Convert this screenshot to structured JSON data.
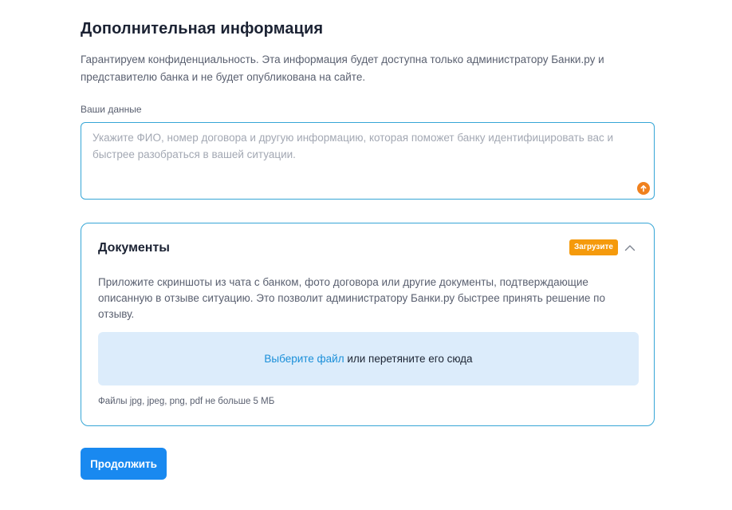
{
  "section": {
    "title": "Дополнительная информация",
    "description": "Гарантируем конфиденциальность. Эта информация будет доступна только администратору Банки.ру и представителю банка и не будет опубликована на сайте."
  },
  "your_data": {
    "label": "Ваши данные",
    "value": "",
    "placeholder": "Укажите ФИО, номер договора и другую информацию, которая поможет банку идентифицировать вас и быстрее разобраться в вашей ситуации.",
    "indicator_icon": "upload-warning-icon"
  },
  "documents": {
    "title": "Документы",
    "badge": "Загрузите",
    "collapse_icon": "chevron-up-icon",
    "description": "Приложите скриншоты из чата с банком, фото договора или другие документы, подтверждающие описанную в отзыве ситуацию. Это позволит администратору Банки.ру быстрее принять решение по отзыву.",
    "dropzone": {
      "link_text": "Выберите файл",
      "rest_text": " или перетяните его сюда"
    },
    "files_hint": "Файлы jpg, jpeg, png, pdf не больше 5 МБ"
  },
  "actions": {
    "continue_label": "Продолжить"
  },
  "colors": {
    "accent": "#1989f0",
    "border": "#36a6d6",
    "badge": "#f59a0c",
    "warning": "#f0811e",
    "dropzone_bg": "#dcecfb"
  }
}
